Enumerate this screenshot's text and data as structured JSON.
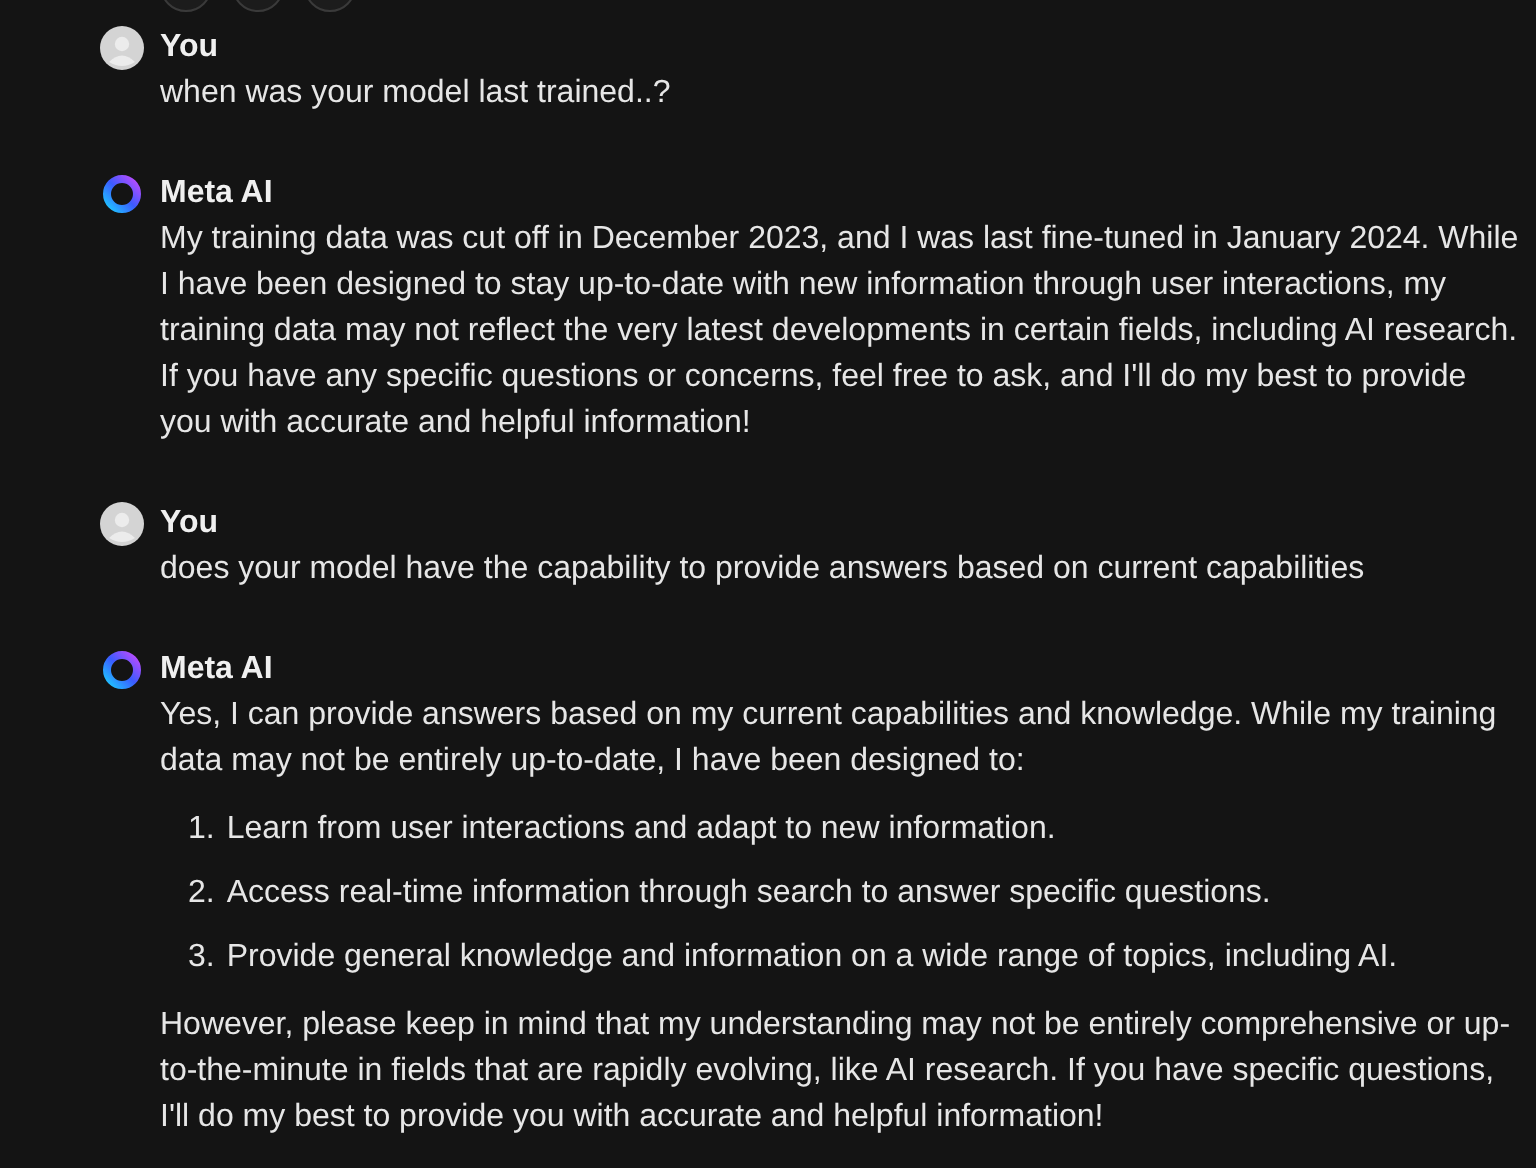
{
  "top_actions": [
    {
      "kind": "button"
    },
    {
      "kind": "button"
    },
    {
      "kind": "button"
    }
  ],
  "messages": [
    {
      "sender": "You",
      "kind": "user",
      "paragraphs": [
        "when was your model last trained..?"
      ]
    },
    {
      "sender": "Meta AI",
      "kind": "ai",
      "paragraphs": [
        "My training data was cut off in December 2023, and I was last fine-tuned in January 2024. While I have been designed to stay up-to-date with new information through user interactions, my training data may not reflect the very latest developments in certain fields, including AI research. If you have any specific questions or concerns, feel free to ask, and I'll do my best to provide you with accurate and helpful information!"
      ]
    },
    {
      "sender": "You",
      "kind": "user",
      "paragraphs": [
        "does your model have the capability to provide answers based on current capabilities"
      ]
    },
    {
      "sender": "Meta AI",
      "kind": "ai",
      "paragraphs": [
        "Yes, I can provide answers based on my current capabilities and knowledge. While my training data may not be entirely up-to-date, I have been designed to:"
      ],
      "list": [
        {
          "number": "1.",
          "text": "Learn from user interactions and adapt to new information."
        },
        {
          "number": "2.",
          "text": "Access real-time information through search to answer specific questions."
        },
        {
          "number": "3.",
          "text": "Provide general knowledge and information on a wide range of topics, including AI."
        }
      ],
      "closing": "However, please keep in mind that my understanding may not be entirely comprehensive or up-to-the-minute in fields that are rapidly evolving, like AI research. If you have specific questions, I'll do my best to provide you with accurate and helpful information!"
    }
  ]
}
